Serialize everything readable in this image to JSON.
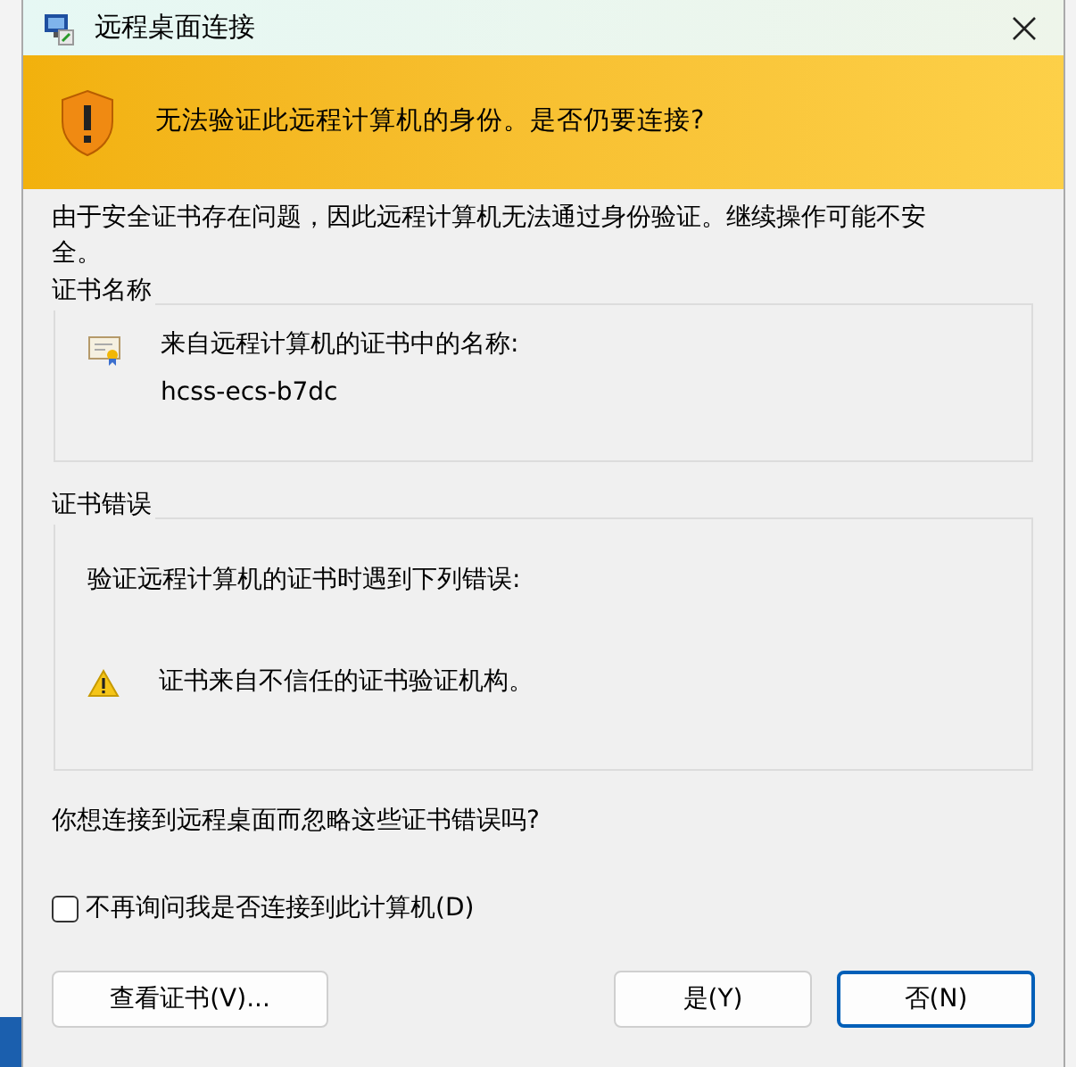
{
  "window": {
    "title": "远程桌面连接"
  },
  "banner": {
    "text": "无法验证此远程计算机的身份。是否仍要连接?"
  },
  "intro": "由于安全证书存在问题，因此远程计算机无法通过身份验证。继续操作可能不安全。",
  "cert_name": {
    "title": "证书名称",
    "label": "来自远程计算机的证书中的名称:",
    "value": "hcss-ecs-b7dc"
  },
  "cert_errors": {
    "title": "证书错误",
    "intro": "验证远程计算机的证书时遇到下列错误:",
    "errors": [
      "证书来自不信任的证书验证机构。"
    ]
  },
  "question": "你想连接到远程桌面而忽略这些证书错误吗?",
  "dont_ask": {
    "label": "不再询问我是否连接到此计算机(D)",
    "checked": false
  },
  "buttons": [
    {
      "label": "查看证书(V)...",
      "kind": "secondary",
      "focused": false
    },
    {
      "label": "是(Y)",
      "kind": "primary",
      "focused": false
    },
    {
      "label": "否(N)",
      "kind": "primary",
      "focused": true
    }
  ]
}
